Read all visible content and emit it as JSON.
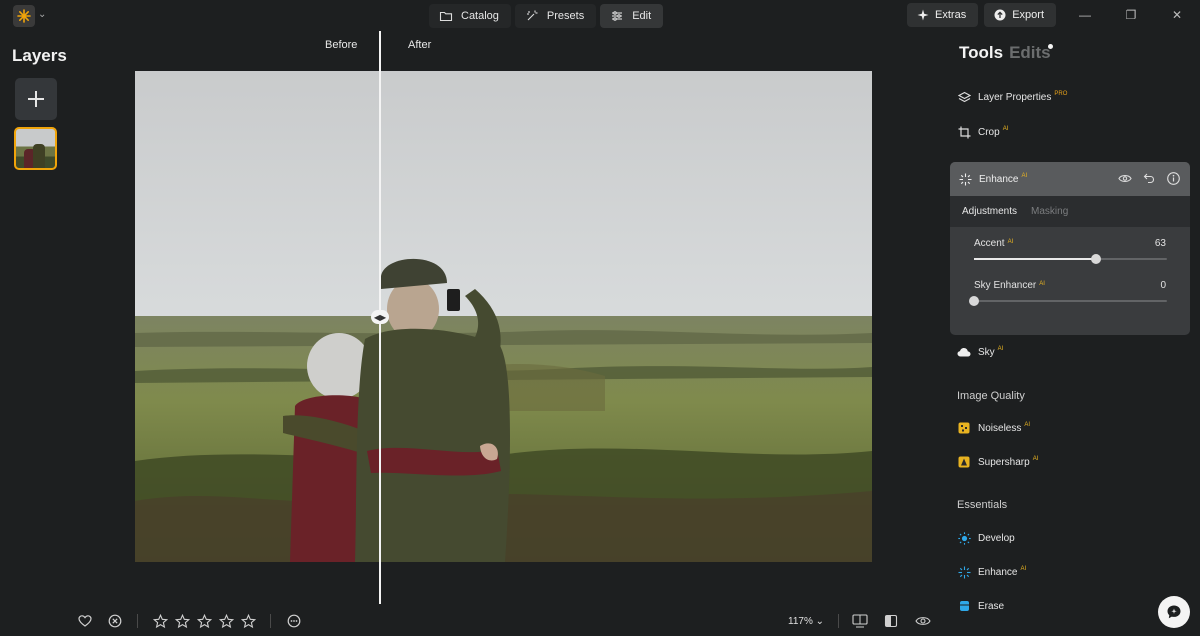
{
  "topbar": {
    "tabs": [
      {
        "label": "Catalog",
        "icon": "folder-icon"
      },
      {
        "label": "Presets",
        "icon": "magic-wand-icon"
      },
      {
        "label": "Edit",
        "icon": "sliders-icon"
      }
    ],
    "extras_label": "Extras",
    "export_label": "Export",
    "accent": "#f0a40a"
  },
  "layers": {
    "title": "Layers"
  },
  "canvas": {
    "before_label": "Before",
    "after_label": "After"
  },
  "bottombar": {
    "zoom_label": "117%",
    "rating_stars": 5
  },
  "tools": {
    "tab_tools": "Tools",
    "tab_edits": "Edits",
    "layer_properties": {
      "label": "Layer Properties",
      "badge": "PRO"
    },
    "crop": {
      "label": "Crop",
      "badge": "AI"
    },
    "enhance": {
      "label": "Enhance",
      "badge": "AI",
      "tab_adjustments": "Adjustments",
      "tab_masking": "Masking",
      "sliders": [
        {
          "label": "Accent",
          "badge": "AI",
          "value": "63",
          "fraction": 0.63
        },
        {
          "label": "Sky Enhancer",
          "badge": "AI",
          "value": "0",
          "fraction": 0.0
        }
      ]
    },
    "sky": {
      "label": "Sky",
      "badge": "AI"
    },
    "image_quality": {
      "title": "Image Quality",
      "noiseless": {
        "label": "Noiseless",
        "badge": "AI"
      },
      "supersharp": {
        "label": "Supersharp",
        "badge": "AI"
      }
    },
    "essentials": {
      "title": "Essentials",
      "develop": {
        "label": "Develop"
      },
      "enhance": {
        "label": "Enhance",
        "badge": "AI"
      },
      "erase": {
        "label": "Erase"
      }
    }
  }
}
